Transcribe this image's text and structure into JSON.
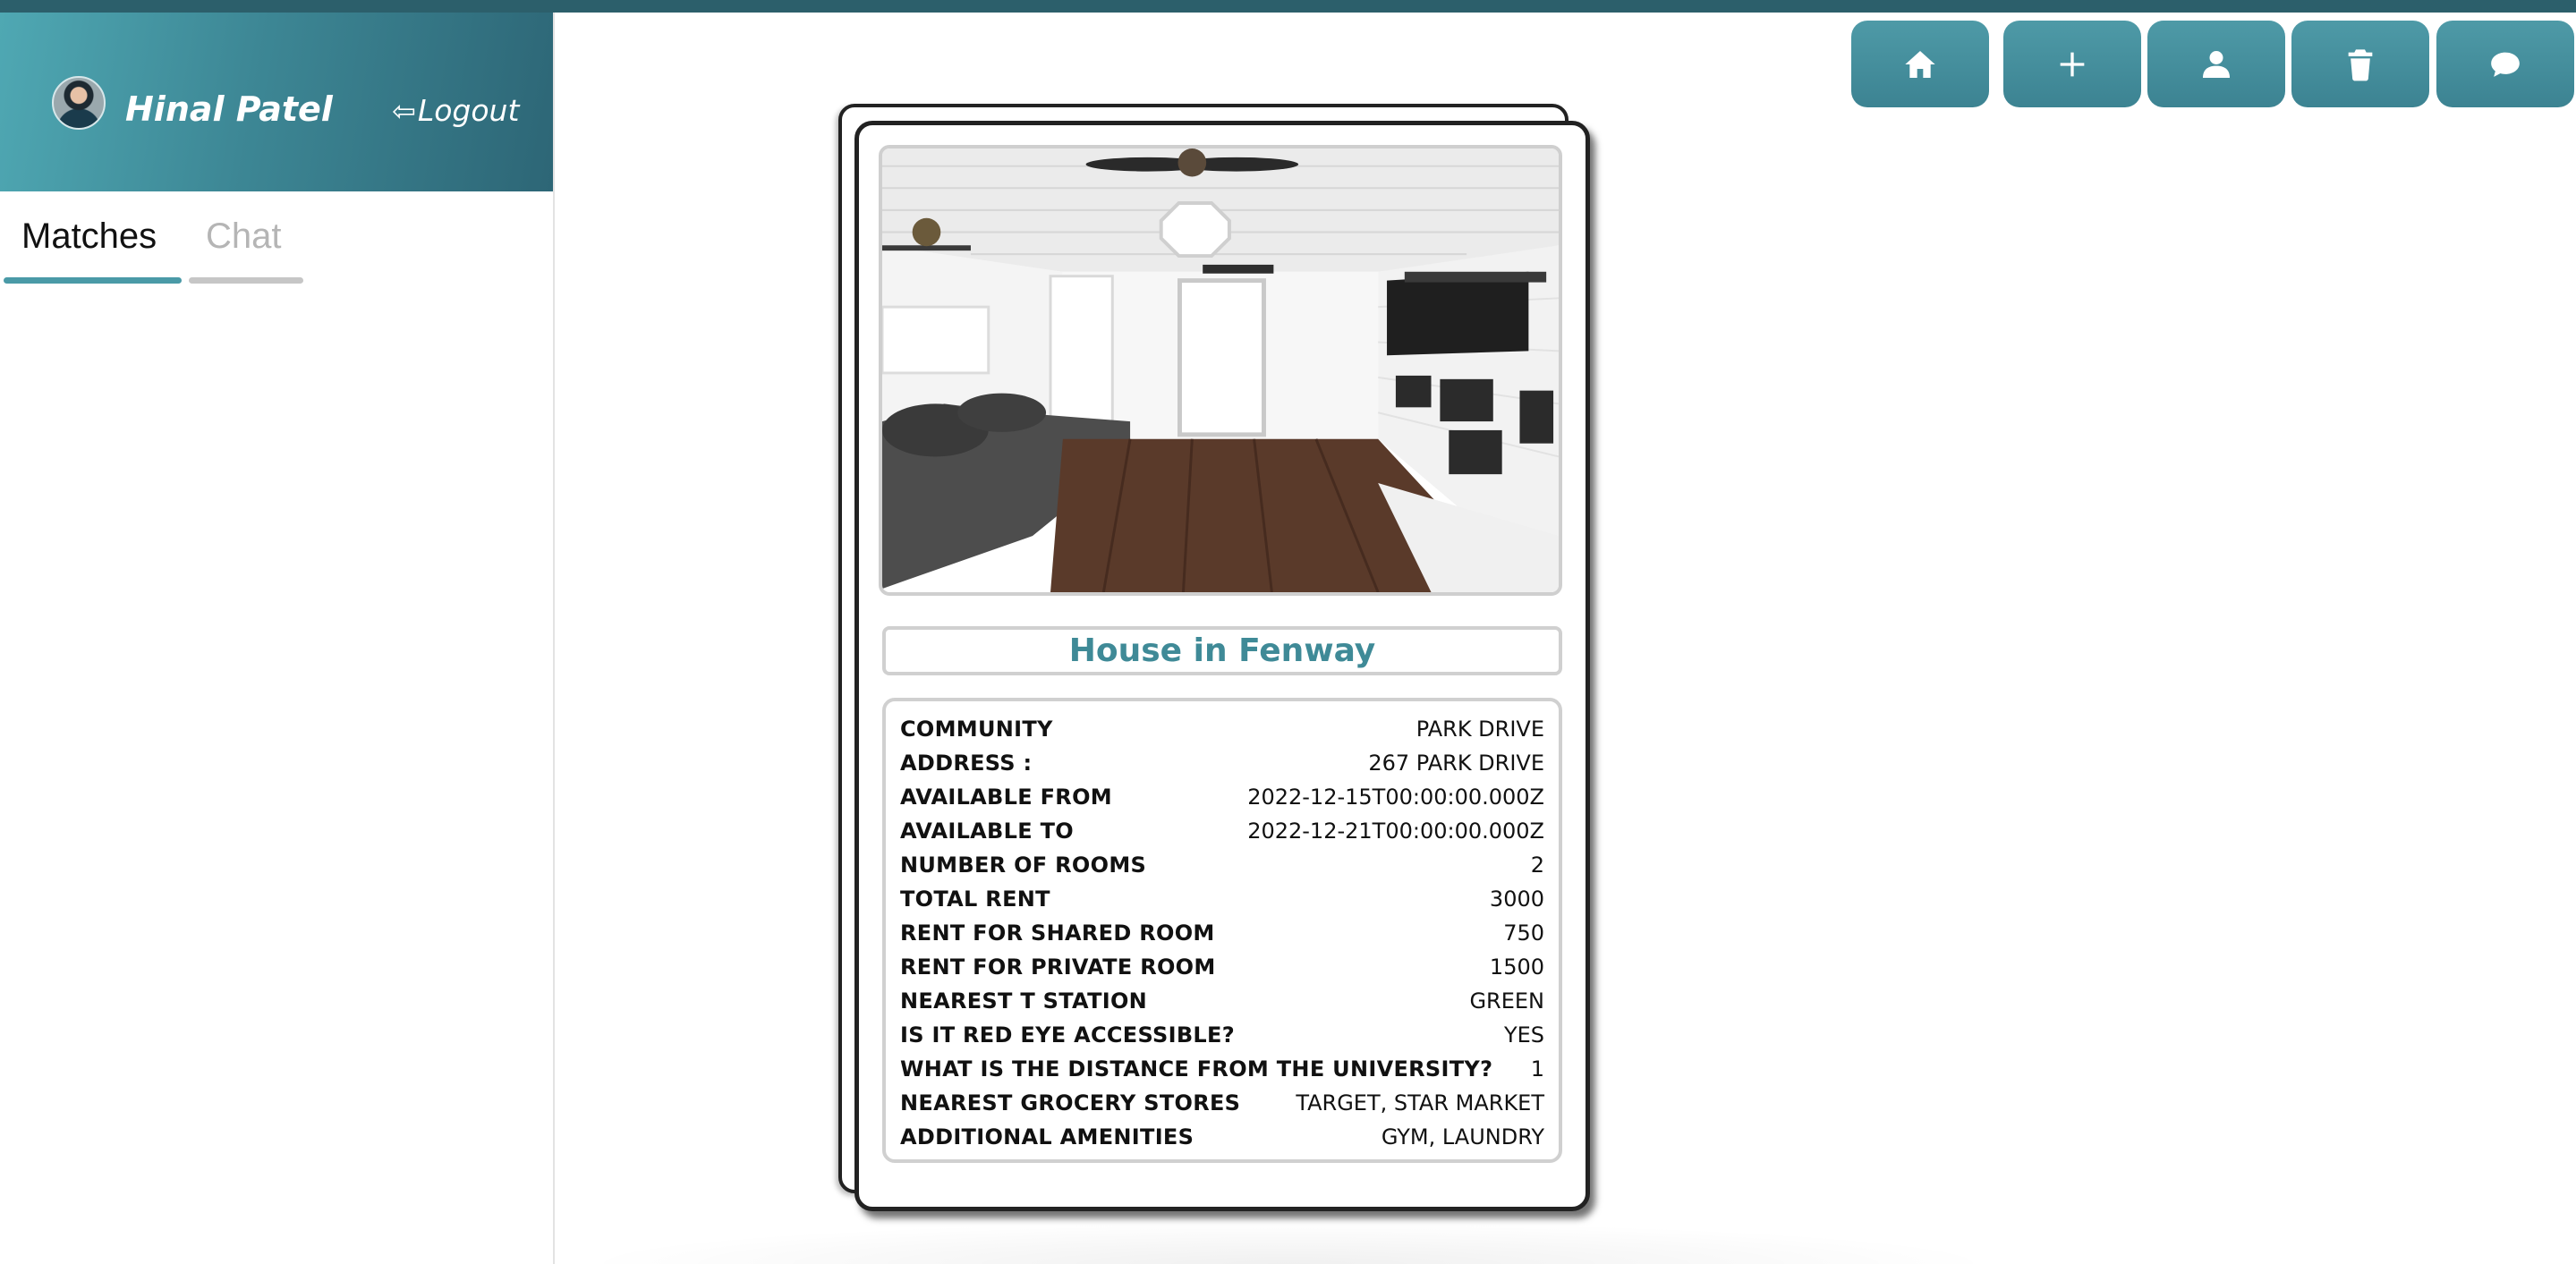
{
  "user": {
    "name": "Hinal Patel",
    "logout_label": "Logout",
    "logout_arrow": "⇦"
  },
  "tabs": [
    {
      "label": "Matches",
      "active": true
    },
    {
      "label": "Chat",
      "active": false
    }
  ],
  "actions": [
    {
      "icon": "home-icon"
    },
    {
      "icon": "plus-icon"
    },
    {
      "icon": "user-icon"
    },
    {
      "icon": "trash-icon"
    },
    {
      "icon": "chat-bubble-icon"
    }
  ],
  "listing": {
    "title": "House in Fenway",
    "photo_subject": "living room interior",
    "details": [
      {
        "label": "COMMUNITY",
        "value": "PARK DRIVE"
      },
      {
        "label": "ADDRESS :",
        "value": "267 PARK DRIVE"
      },
      {
        "label": "AVAILABLE FROM",
        "value": "2022-12-15T00:00:00.000Z"
      },
      {
        "label": "AVAILABLE TO",
        "value": "2022-12-21T00:00:00.000Z"
      },
      {
        "label": "NUMBER OF ROOMS",
        "value": "2"
      },
      {
        "label": "TOTAL RENT",
        "value": "3000"
      },
      {
        "label": "RENT FOR SHARED ROOM",
        "value": "750"
      },
      {
        "label": "RENT FOR PRIVATE ROOM",
        "value": "1500"
      },
      {
        "label": "NEAREST T STATION",
        "value": "GREEN"
      },
      {
        "label": "IS IT RED EYE ACCESSIBLE?",
        "value": "YES"
      },
      {
        "label": "WHAT IS THE DISTANCE FROM THE UNIVERSITY?",
        "value": "1"
      },
      {
        "label": "NEAREST GROCERY STORES",
        "value": "TARGET, STAR MARKET"
      },
      {
        "label": "ADDITIONAL AMENITIES",
        "value": "GYM, LAUNDRY"
      }
    ]
  },
  "colors": {
    "accent": "#3f8a97",
    "topbar": "#2c5f6b",
    "button": "#4e9aa7"
  }
}
